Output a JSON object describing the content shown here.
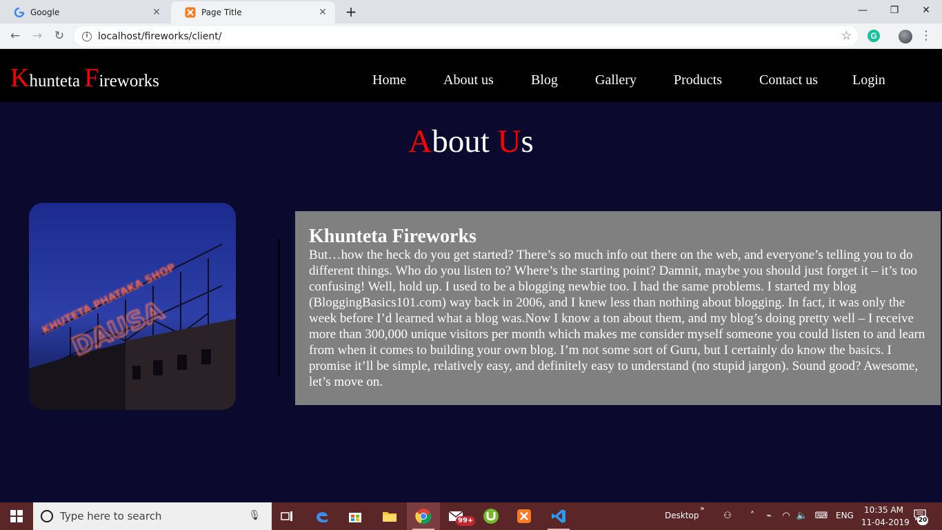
{
  "browser": {
    "tabs": [
      {
        "title": "Google"
      },
      {
        "title": "Page Title"
      }
    ],
    "url": "localhost/fireworks/client/"
  },
  "site": {
    "logo": {
      "cap1": "K",
      "rest1": "hunteta ",
      "cap2": "F",
      "rest2": "ireworks"
    },
    "nav": [
      "Home",
      "About us",
      "Blog",
      "Gallery",
      "Products",
      "Contact us",
      "Login"
    ],
    "heading": {
      "cap1": "A",
      "rest1": "bout ",
      "cap2": "U",
      "rest2": "s"
    },
    "image": {
      "sign_top": "KHUTETA PHATAKA SHOP",
      "sign_main": "DAUSA"
    },
    "about": {
      "title": "Khunteta Fireworks",
      "body": "But…how the heck do you get started? There’s so much info out there on the web, and everyone’s telling you to do different things. Who do you listen to? Where’s the starting point? Damnit, maybe you should just forget it – it’s too confusing! Well, hold up. I used to be a blogging newbie too. I had the same problems. I started my blog (BloggingBasics101.com) way back in 2006, and I knew less than nothing about blogging. In fact, it was only the week before I’d learned what a blog was.Now I know a ton about them, and my blog’s doing pretty well – I receive more than 300,000 unique visitors per month which makes me consider myself someone you could listen to and learn from when it comes to building your own blog. I’m not some sort of Guru, but I certainly do know the basics. I promise it’ll be simple, relatively easy, and definitely easy to understand (no stupid jargon). Sound good? Awesome, let’s move on."
    }
  },
  "taskbar": {
    "search_placeholder": "Type here to search",
    "mail_badge": "99+",
    "desktop_label": "Desktop",
    "language": "ENG",
    "time": "10:35 AM",
    "date": "11-04-2019",
    "notifications": "20"
  },
  "colors": {
    "accent_red": "#ff0000",
    "page_bg": "#0b0a2e",
    "header_bg": "#000000",
    "about_bg": "#808080",
    "taskbar_bg": "#5a2628"
  }
}
